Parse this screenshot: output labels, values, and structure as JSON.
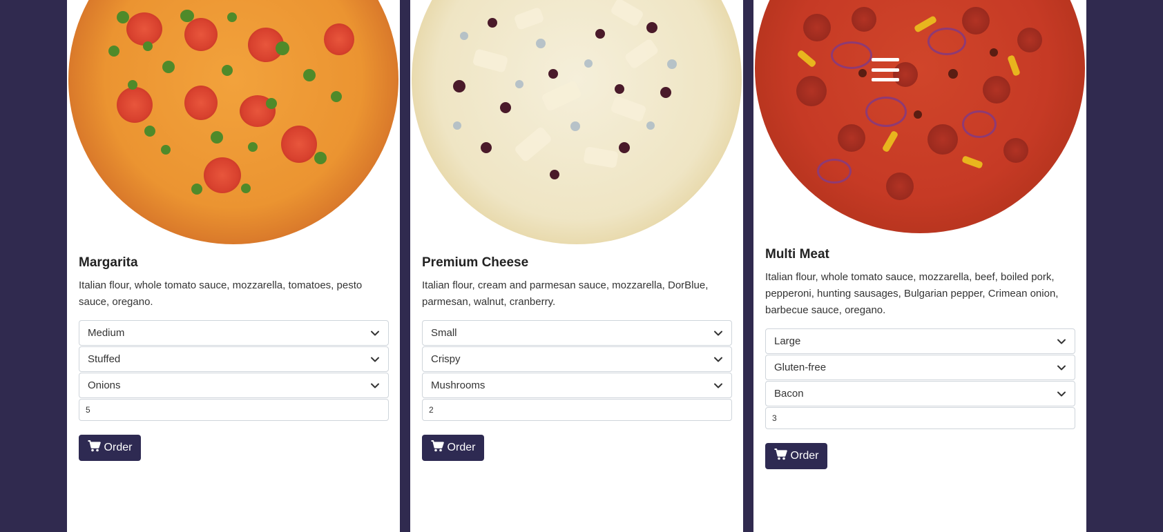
{
  "menu": {
    "icon": "hamburger-menu-icon"
  },
  "pizzas": [
    {
      "name": "Margarita",
      "description": "Italian flour, whole tomato sauce, mozzarella, tomatoes, pesto sauce, oregano.",
      "size": "Medium",
      "crust": "Stuffed",
      "extra": "Onions",
      "quantity": "5",
      "order_label": "Order"
    },
    {
      "name": "Premium Cheese",
      "description": "Italian flour, cream and parmesan sauce, mozzarella, DorBlue, parmesan, walnut, cranberry.",
      "size": "Small",
      "crust": "Crispy",
      "extra": "Mushrooms",
      "quantity": "2",
      "order_label": "Order"
    },
    {
      "name": "Multi Meat",
      "description": "Italian flour, whole tomato sauce, mozzarella, beef, boiled pork, pepperoni, hunting sausages, Bulgarian pepper, Crimean onion, barbecue sauce, oregano.",
      "size": "Large",
      "crust": "Gluten-free",
      "extra": "Bacon",
      "quantity": "3",
      "order_label": "Order"
    }
  ],
  "colors": {
    "background": "#302a4f",
    "button": "#2e2a52",
    "card": "#ffffff"
  }
}
